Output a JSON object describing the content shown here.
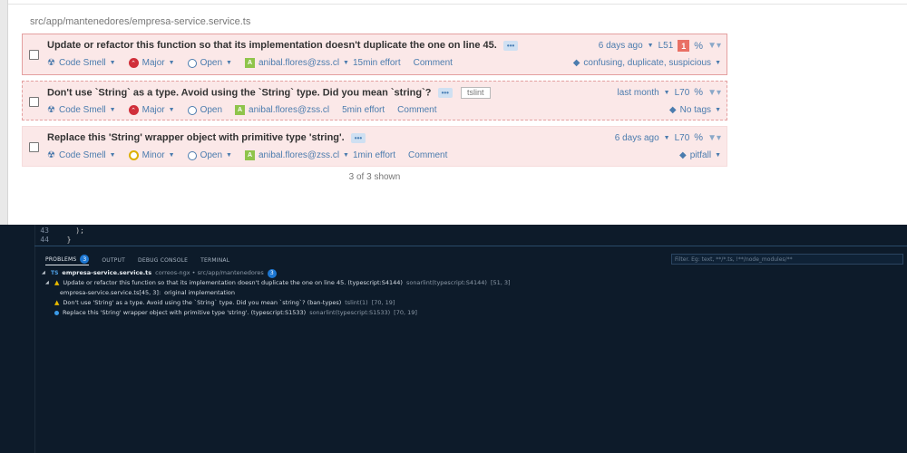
{
  "filepath": "src/app/mantenedores/empresa-service.service.ts",
  "issues": [
    {
      "message": "Update or refactor this function so that its implementation doesn't duplicate the one on line 45.",
      "ellipsis": "•••",
      "type": "Code Smell",
      "severity": "Major",
      "status": "Open",
      "avatar": "A",
      "assignee": "anibal.flores@zss.cl",
      "effort": "15min effort",
      "comment": "Comment",
      "age": "6 days ago",
      "line": "L51",
      "locations": "1",
      "tags": "confusing, duplicate, suspicious"
    },
    {
      "message": "Don't use `String` as a type. Avoid using the `String` type. Did you mean `string`?",
      "ellipsis": "•••",
      "rule_tag": "tslint",
      "type": "Code Smell",
      "severity": "Major",
      "status": "Open",
      "avatar": "A",
      "assignee": "anibal.flores@zss.cl",
      "effort": "5min effort",
      "comment": "Comment",
      "age": "last month",
      "line": "L70",
      "tags": "No tags"
    },
    {
      "message": "Replace this 'String' wrapper object with primitive type 'string'.",
      "ellipsis": "•••",
      "type": "Code Smell",
      "severity": "Minor",
      "status": "Open",
      "avatar": "A",
      "assignee": "anibal.flores@zss.cl",
      "effort": "1min effort",
      "comment": "Comment",
      "age": "6 days ago",
      "line": "L70",
      "tags": "pitfall"
    }
  ],
  "shown_text": "3 of 3 shown",
  "editor": {
    "lines": [
      {
        "num": "43",
        "code": "    );"
      },
      {
        "num": "44",
        "code": "  }"
      }
    ]
  },
  "panel": {
    "tabs": [
      {
        "label": "PROBLEMS",
        "count": "3"
      },
      {
        "label": "OUTPUT"
      },
      {
        "label": "DEBUG CONSOLE"
      },
      {
        "label": "TERMINAL"
      }
    ],
    "filter_placeholder": "Filter. Eg: text, **/*.ts, !**/node_modules/**",
    "file": {
      "badge": "TS",
      "name": "empresa-service.service.ts",
      "path": "correos-ngx • src/app/mantenedores",
      "count": "3"
    },
    "problems": [
      {
        "severity": "warning",
        "message": "Update or refactor this function so that its implementation doesn't duplicate the one on line 45. (typescript:S4144)",
        "source": "sonarlint(typescript:S4144)",
        "pos": "[51, 3]",
        "related": {
          "file": "empresa-service.service.ts[45, 3]:",
          "text": "original implementation"
        }
      },
      {
        "severity": "warning",
        "message": "Don't use 'String' as a type. Avoid using the `String` type. Did you mean `string`? (ban-types)",
        "source": "tslint(1)",
        "pos": "[70, 19]"
      },
      {
        "severity": "info",
        "message": "Replace this 'String' wrapper object with primitive type 'string'. (typescript:S1533)",
        "source": "sonarlint(typescript:S1533)",
        "pos": "[70, 19]"
      }
    ]
  }
}
